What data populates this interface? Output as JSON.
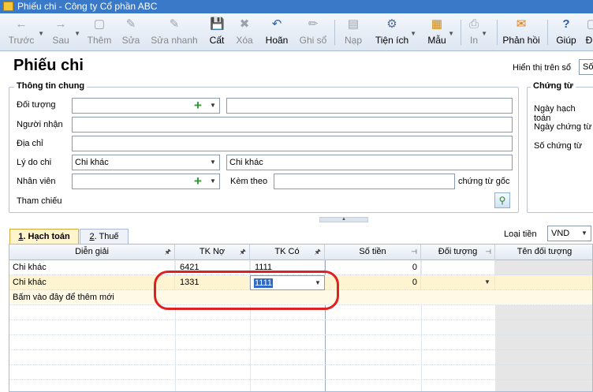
{
  "window": {
    "title": "Phiếu chi - Công ty Cổ phần ABC"
  },
  "toolbar": [
    {
      "label": "Trước",
      "icon": "←",
      "enabled": false,
      "has_dropdown": true
    },
    {
      "label": "Sau",
      "icon": "→",
      "enabled": false,
      "has_dropdown": true
    },
    {
      "label": "Thêm",
      "icon": "▢",
      "enabled": false
    },
    {
      "label": "Sửa",
      "icon": "✎",
      "enabled": false
    },
    {
      "label": "Sửa nhanh",
      "icon": "✎",
      "enabled": false
    },
    {
      "label": "Cất",
      "icon": "💾",
      "enabled": true
    },
    {
      "label": "Xóa",
      "icon": "✖",
      "enabled": false
    },
    {
      "label": "Hoãn",
      "icon": "↶",
      "enabled": true
    },
    {
      "label": "Ghi sổ",
      "icon": "✏",
      "enabled": false
    },
    {
      "label": "Nạp",
      "icon": "▤",
      "enabled": false
    },
    {
      "label": "Tiện ích",
      "icon": "⚙",
      "enabled": true,
      "has_dropdown": true
    },
    {
      "label": "Mẫu",
      "icon": "▦",
      "enabled": true,
      "has_dropdown": true
    },
    {
      "label": "In",
      "icon": "⎙",
      "enabled": false,
      "has_dropdown": true
    },
    {
      "label": "Phản hồi",
      "icon": "✉",
      "enabled": true
    },
    {
      "label": "Giúp",
      "icon": "?",
      "enabled": true
    },
    {
      "label": "Đ",
      "icon": "▢",
      "enabled": true
    }
  ],
  "page": {
    "title": "Phiếu chi",
    "hien_thi_label": "Hiển thị trên sổ",
    "hien_thi_value": "Số"
  },
  "general": {
    "title": "Thông tin chung",
    "doi_tuong": {
      "label": "Đối tượng",
      "value": "",
      "name_value": ""
    },
    "nguoi_nhan": {
      "label": "Người nhận",
      "value": ""
    },
    "dia_chi": {
      "label": "Địa chỉ",
      "value": ""
    },
    "ly_do_chi": {
      "label": "Lý do chi",
      "value": "Chi khác",
      "desc": "Chi khác"
    },
    "nhan_vien": {
      "label": "Nhân viên",
      "value": ""
    },
    "kem_theo": {
      "label": "Kèm theo",
      "value": "",
      "suffix": "chứng từ gốc"
    },
    "tham_chieu": {
      "label": "Tham chiếu"
    }
  },
  "voucher": {
    "title": "Chứng từ",
    "ngay_hach_toan": "Ngày hạch toán",
    "ngay_chung_tu": "Ngày chứng từ",
    "so_chung_tu": "Số chứng từ"
  },
  "tabs": [
    {
      "num": "1",
      "label": ". Hạch toán",
      "active": true
    },
    {
      "num": "2",
      "label": ". Thuế",
      "active": false
    }
  ],
  "currency": {
    "label": "Loại tiền",
    "value": "VND"
  },
  "grid": {
    "columns": [
      "Diễn giải",
      "TK Nợ",
      "TK Có",
      "Số tiền",
      "Đối tượng",
      "Tên đối tượng"
    ],
    "rows": [
      {
        "dien_giai": "Chi khác",
        "tk_no": "6421",
        "tk_co": "1111",
        "so_tien": "0",
        "doi_tuong": "",
        "ten_doi_tuong": ""
      },
      {
        "dien_giai": "Chi khác",
        "tk_no": "1331",
        "tk_co": "1111",
        "so_tien": "0",
        "doi_tuong": "",
        "ten_doi_tuong": ""
      }
    ],
    "add_new_text": "Bấm vào đây để thêm mới"
  },
  "colors": {
    "titlebar": "#3a78c8",
    "highlight_row": "#fff4d2",
    "annotation": "#e01f1f",
    "add_icon": "#2e9b2e"
  }
}
